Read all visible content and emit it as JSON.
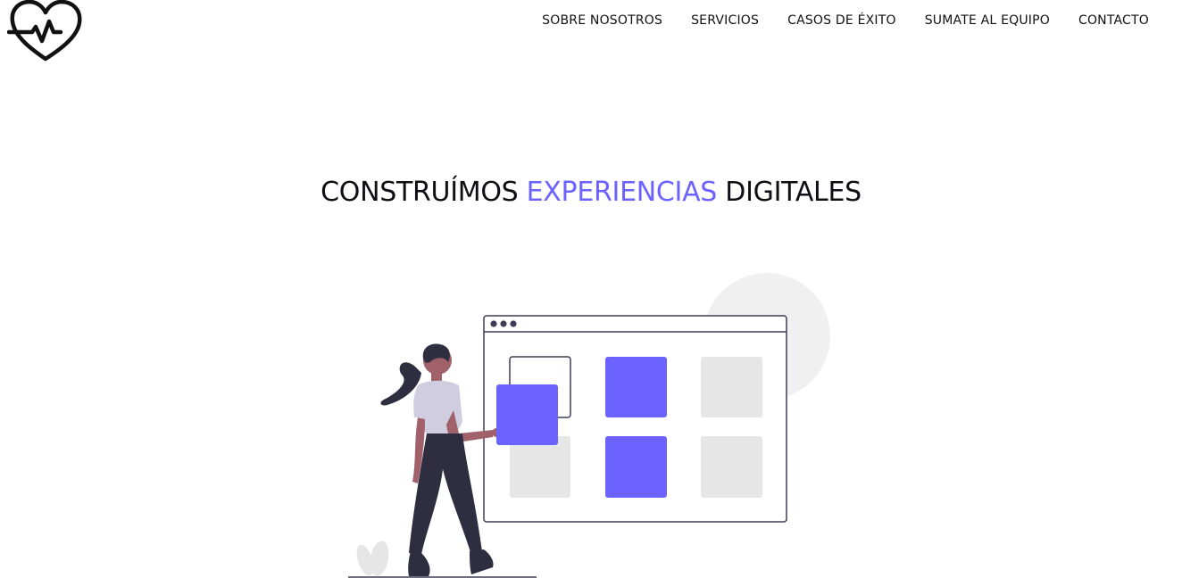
{
  "header": {
    "logo_icon": "heart-pulse-icon",
    "nav": [
      {
        "label": "SOBRE NOSOTROS"
      },
      {
        "label": "SERVICIOS"
      },
      {
        "label": "CASOS DE ÉXITO"
      },
      {
        "label": "SUMATE AL EQUIPO"
      },
      {
        "label": "CONTACTO"
      }
    ]
  },
  "hero": {
    "title_before": "CONSTRUÍMOS ",
    "title_accent": "EXPERIENCIAS",
    "title_after": " DIGITALES"
  },
  "colors": {
    "accent": "#6c63ff",
    "dark": "#2f2e41",
    "placeholder": "#e6e6e6"
  },
  "illustration": {
    "icon": "woman-arranging-layout-illustration"
  }
}
